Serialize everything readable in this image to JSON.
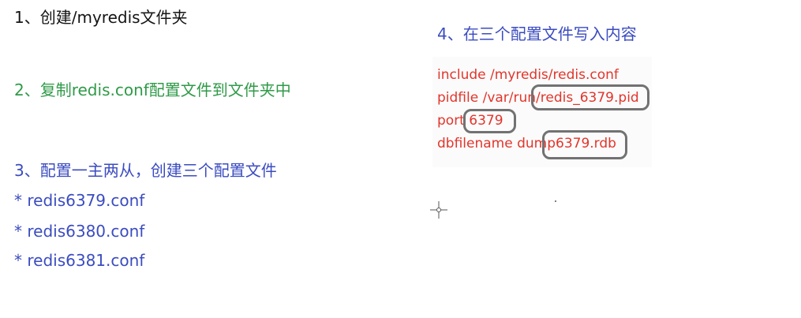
{
  "left": {
    "step1": "1、创建/myredis文件夹",
    "step2": "2、复制redis.conf配置文件到文件夹中",
    "step3": "3、配置一主两从，创建三个配置文件",
    "files": [
      "* redis6379.conf",
      "* redis6380.conf",
      "* redis6381.conf"
    ]
  },
  "right": {
    "step4": "4、在三个配置文件写入内容",
    "code_lines": [
      "include /myredis/redis.conf",
      "pidfile /var/run/redis_6379.pid",
      "port 6379",
      "dbfilename dump6379.rdb"
    ]
  },
  "colors": {
    "step1": "#141414",
    "step2_green": "#2f9a48",
    "blue": "#3b4cc0",
    "code_red": "#e2352b",
    "highlight_gray": "#727272"
  },
  "icons": {
    "cursor": "crosshair-cursor-icon"
  }
}
